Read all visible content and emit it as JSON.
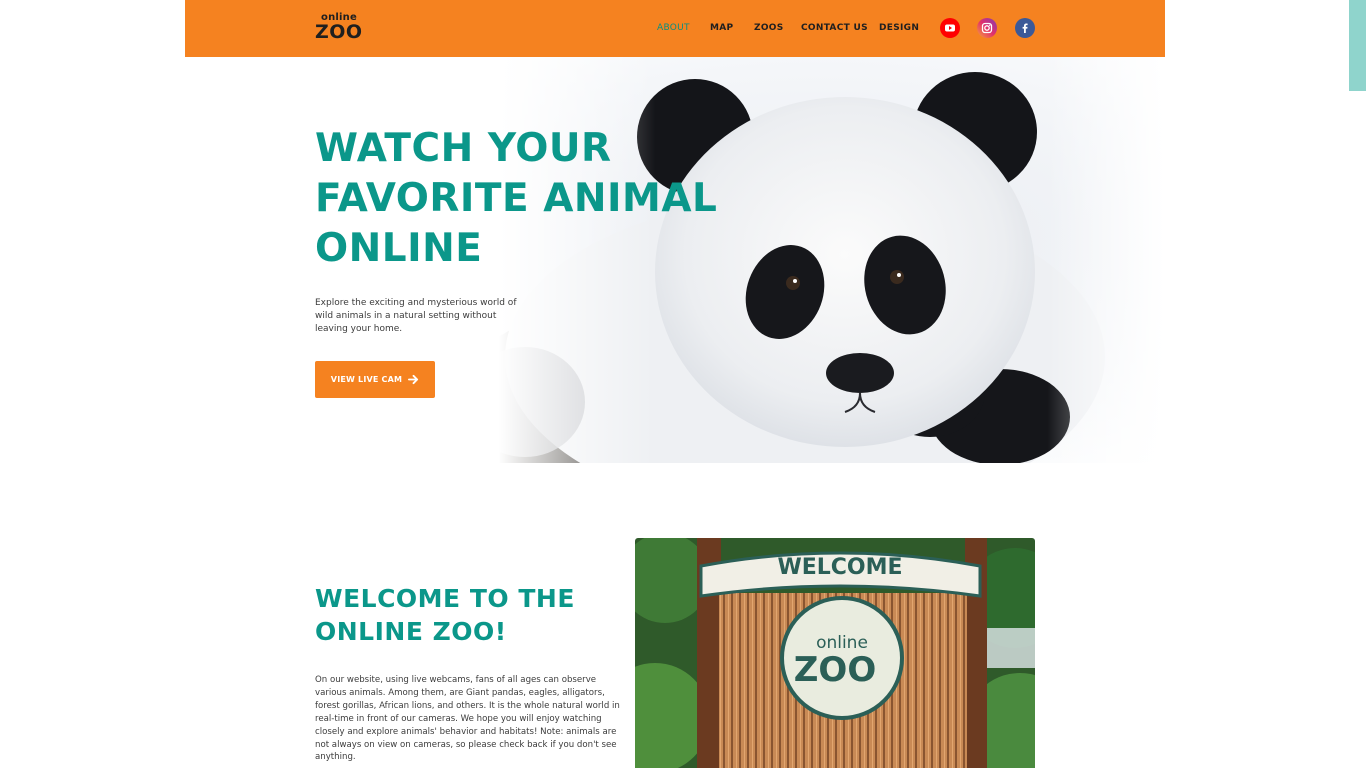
{
  "header": {
    "logo": {
      "top": "online",
      "main": "ZOO"
    },
    "nav": [
      {
        "label": "ABOUT",
        "active": true
      },
      {
        "label": "MAP",
        "active": false
      },
      {
        "label": "ZOOS",
        "active": false
      },
      {
        "label": "CONTACT US",
        "active": false
      },
      {
        "label": "DESIGN",
        "active": false
      }
    ],
    "social": [
      {
        "icon": "youtube-icon",
        "color": "#ff0000"
      },
      {
        "icon": "instagram-icon",
        "color": "#c13584"
      },
      {
        "icon": "facebook-icon",
        "color": "#3b5998"
      }
    ]
  },
  "hero": {
    "title_line1": "WATCH YOUR",
    "title_line2": "FAVORITE ANIMAL",
    "title_line3": "ONLINE",
    "subtitle": "Explore the exciting and mysterious world of wild animals in a natural setting without leaving your home.",
    "cta_label": "VIEW LIVE CAM"
  },
  "welcome": {
    "title_line1": "WELCOME TO THE",
    "title_line2": "ONLINE ZOO!",
    "body": "On our website, using live webcams, fans of all ages can observe various animals. Among them, are Giant pandas, eagles, alligators, forest gorillas, African lions, and others. It is the whole natural world in real-time in front of our cameras. We hope you will enjoy watching closely and explore animals' behavior and habitats! Note: animals are not always on view on cameras, so please check back if you don't see anything.",
    "sign_header": "WELCOME",
    "sign_logo_top": "online",
    "sign_logo_main": "ZOO"
  },
  "colors": {
    "accent_orange": "#f58220",
    "teal": "#0b978a",
    "scroll_accent": "#8fd4cc"
  }
}
